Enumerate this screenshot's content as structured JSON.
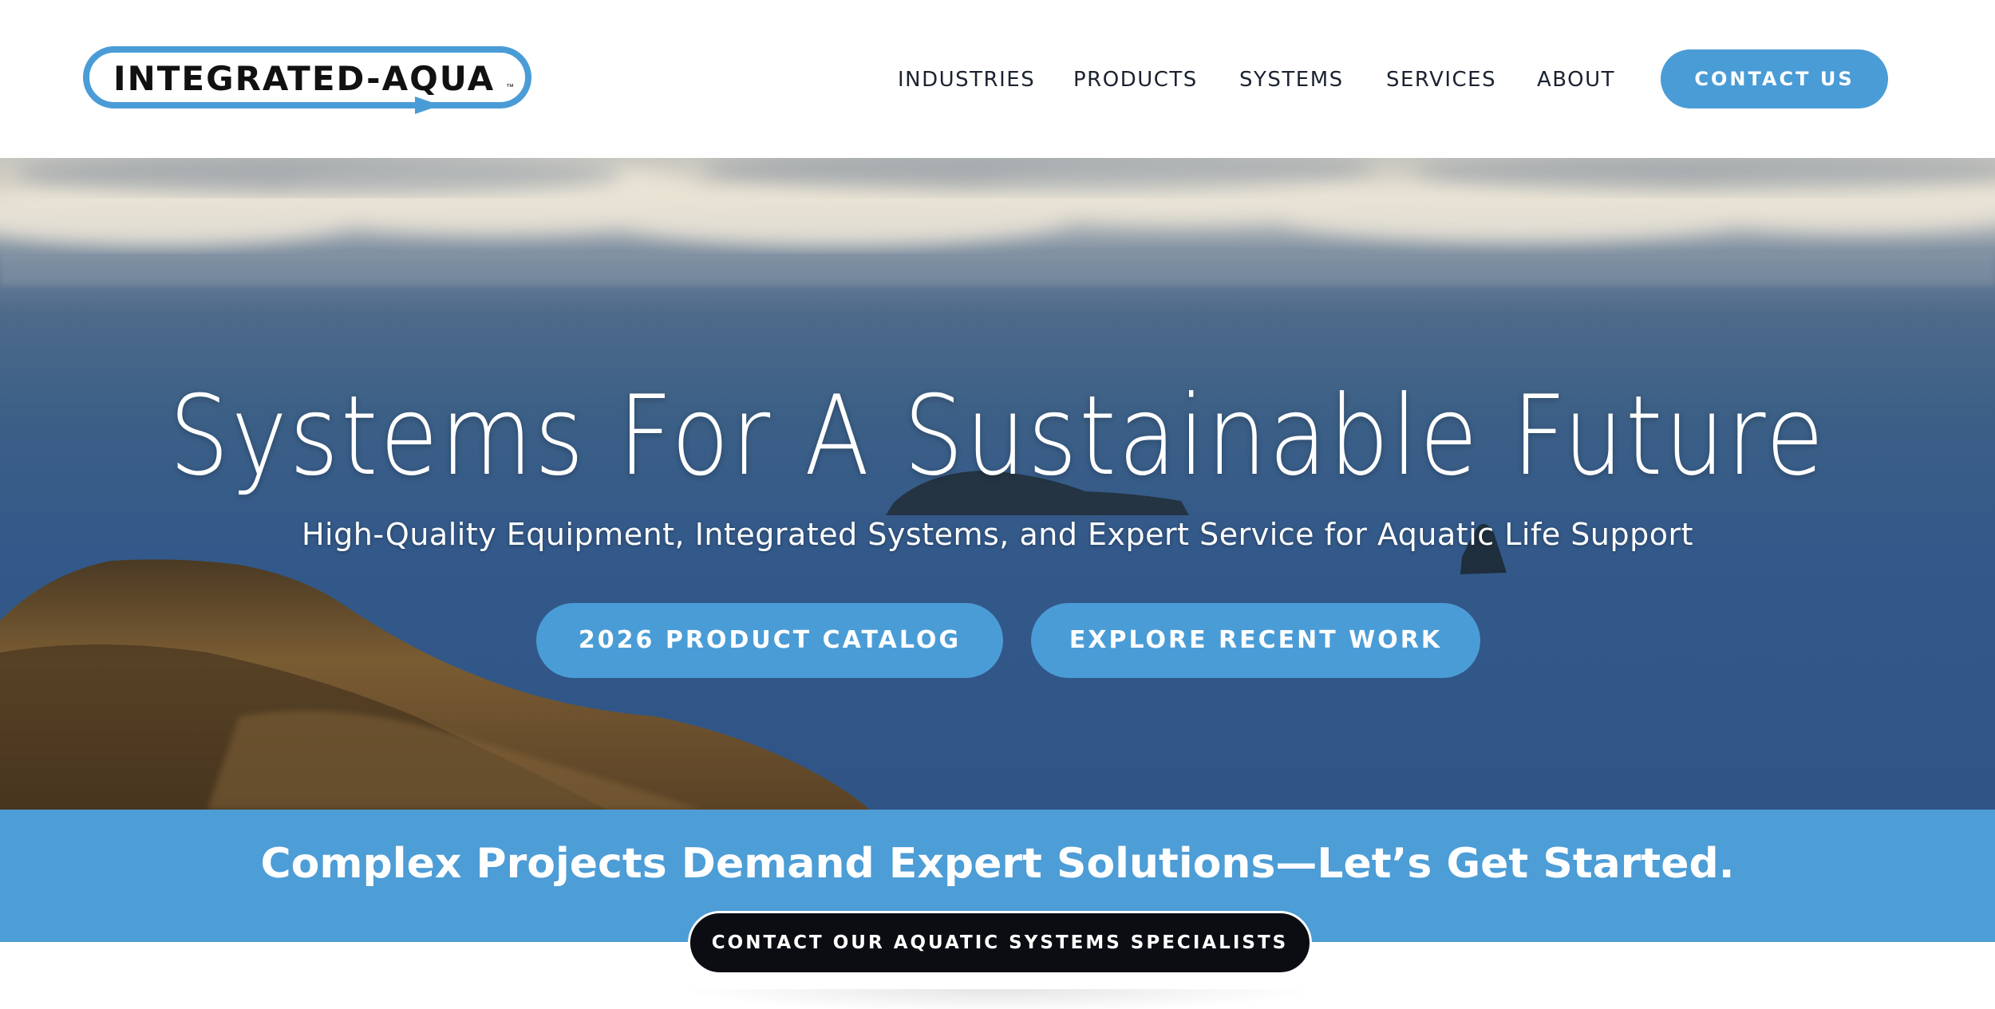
{
  "brand": {
    "logo_text": "INTEGRATED-AQUA",
    "logo_tm": "™",
    "accent_color": "#4a9cd6"
  },
  "nav": {
    "items": [
      {
        "label": "INDUSTRIES"
      },
      {
        "label": "PRODUCTS"
      },
      {
        "label": "SYSTEMS"
      },
      {
        "label": "SERVICES"
      },
      {
        "label": "ABOUT"
      }
    ],
    "contact_label": "CONTACT US"
  },
  "hero": {
    "title": "Systems For A Sustainable Future",
    "subtitle": "High-Quality Equipment, Integrated Systems, and Expert Service for Aquatic Life Support",
    "catalog_button": "2026 PRODUCT CATALOG",
    "work_button": "EXPLORE RECENT WORK"
  },
  "banner": {
    "headline": "Complex Projects Demand Expert Solutions—Let’s Get Started.",
    "cta_label": "CONTACT OUR AQUATIC SYSTEMS SPECIALISTS",
    "background_color": "#4d9dd6",
    "cta_color": "#0b0d12"
  }
}
